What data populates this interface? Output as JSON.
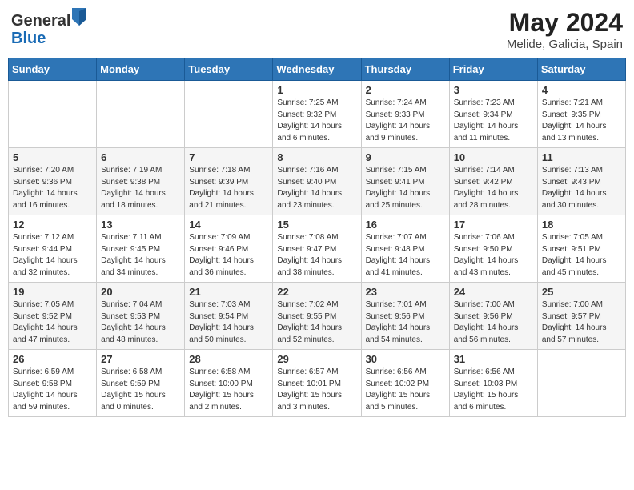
{
  "header": {
    "logo_line1": "General",
    "logo_line2": "Blue",
    "month_year": "May 2024",
    "location": "Melide, Galicia, Spain"
  },
  "days_of_week": [
    "Sunday",
    "Monday",
    "Tuesday",
    "Wednesday",
    "Thursday",
    "Friday",
    "Saturday"
  ],
  "weeks": [
    [
      {
        "day": "",
        "info": ""
      },
      {
        "day": "",
        "info": ""
      },
      {
        "day": "",
        "info": ""
      },
      {
        "day": "1",
        "info": "Sunrise: 7:25 AM\nSunset: 9:32 PM\nDaylight: 14 hours\nand 6 minutes."
      },
      {
        "day": "2",
        "info": "Sunrise: 7:24 AM\nSunset: 9:33 PM\nDaylight: 14 hours\nand 9 minutes."
      },
      {
        "day": "3",
        "info": "Sunrise: 7:23 AM\nSunset: 9:34 PM\nDaylight: 14 hours\nand 11 minutes."
      },
      {
        "day": "4",
        "info": "Sunrise: 7:21 AM\nSunset: 9:35 PM\nDaylight: 14 hours\nand 13 minutes."
      }
    ],
    [
      {
        "day": "5",
        "info": "Sunrise: 7:20 AM\nSunset: 9:36 PM\nDaylight: 14 hours\nand 16 minutes."
      },
      {
        "day": "6",
        "info": "Sunrise: 7:19 AM\nSunset: 9:38 PM\nDaylight: 14 hours\nand 18 minutes."
      },
      {
        "day": "7",
        "info": "Sunrise: 7:18 AM\nSunset: 9:39 PM\nDaylight: 14 hours\nand 21 minutes."
      },
      {
        "day": "8",
        "info": "Sunrise: 7:16 AM\nSunset: 9:40 PM\nDaylight: 14 hours\nand 23 minutes."
      },
      {
        "day": "9",
        "info": "Sunrise: 7:15 AM\nSunset: 9:41 PM\nDaylight: 14 hours\nand 25 minutes."
      },
      {
        "day": "10",
        "info": "Sunrise: 7:14 AM\nSunset: 9:42 PM\nDaylight: 14 hours\nand 28 minutes."
      },
      {
        "day": "11",
        "info": "Sunrise: 7:13 AM\nSunset: 9:43 PM\nDaylight: 14 hours\nand 30 minutes."
      }
    ],
    [
      {
        "day": "12",
        "info": "Sunrise: 7:12 AM\nSunset: 9:44 PM\nDaylight: 14 hours\nand 32 minutes."
      },
      {
        "day": "13",
        "info": "Sunrise: 7:11 AM\nSunset: 9:45 PM\nDaylight: 14 hours\nand 34 minutes."
      },
      {
        "day": "14",
        "info": "Sunrise: 7:09 AM\nSunset: 9:46 PM\nDaylight: 14 hours\nand 36 minutes."
      },
      {
        "day": "15",
        "info": "Sunrise: 7:08 AM\nSunset: 9:47 PM\nDaylight: 14 hours\nand 38 minutes."
      },
      {
        "day": "16",
        "info": "Sunrise: 7:07 AM\nSunset: 9:48 PM\nDaylight: 14 hours\nand 41 minutes."
      },
      {
        "day": "17",
        "info": "Sunrise: 7:06 AM\nSunset: 9:50 PM\nDaylight: 14 hours\nand 43 minutes."
      },
      {
        "day": "18",
        "info": "Sunrise: 7:05 AM\nSunset: 9:51 PM\nDaylight: 14 hours\nand 45 minutes."
      }
    ],
    [
      {
        "day": "19",
        "info": "Sunrise: 7:05 AM\nSunset: 9:52 PM\nDaylight: 14 hours\nand 47 minutes."
      },
      {
        "day": "20",
        "info": "Sunrise: 7:04 AM\nSunset: 9:53 PM\nDaylight: 14 hours\nand 48 minutes."
      },
      {
        "day": "21",
        "info": "Sunrise: 7:03 AM\nSunset: 9:54 PM\nDaylight: 14 hours\nand 50 minutes."
      },
      {
        "day": "22",
        "info": "Sunrise: 7:02 AM\nSunset: 9:55 PM\nDaylight: 14 hours\nand 52 minutes."
      },
      {
        "day": "23",
        "info": "Sunrise: 7:01 AM\nSunset: 9:56 PM\nDaylight: 14 hours\nand 54 minutes."
      },
      {
        "day": "24",
        "info": "Sunrise: 7:00 AM\nSunset: 9:56 PM\nDaylight: 14 hours\nand 56 minutes."
      },
      {
        "day": "25",
        "info": "Sunrise: 7:00 AM\nSunset: 9:57 PM\nDaylight: 14 hours\nand 57 minutes."
      }
    ],
    [
      {
        "day": "26",
        "info": "Sunrise: 6:59 AM\nSunset: 9:58 PM\nDaylight: 14 hours\nand 59 minutes."
      },
      {
        "day": "27",
        "info": "Sunrise: 6:58 AM\nSunset: 9:59 PM\nDaylight: 15 hours\nand 0 minutes."
      },
      {
        "day": "28",
        "info": "Sunrise: 6:58 AM\nSunset: 10:00 PM\nDaylight: 15 hours\nand 2 minutes."
      },
      {
        "day": "29",
        "info": "Sunrise: 6:57 AM\nSunset: 10:01 PM\nDaylight: 15 hours\nand 3 minutes."
      },
      {
        "day": "30",
        "info": "Sunrise: 6:56 AM\nSunset: 10:02 PM\nDaylight: 15 hours\nand 5 minutes."
      },
      {
        "day": "31",
        "info": "Sunrise: 6:56 AM\nSunset: 10:03 PM\nDaylight: 15 hours\nand 6 minutes."
      },
      {
        "day": "",
        "info": ""
      }
    ]
  ]
}
